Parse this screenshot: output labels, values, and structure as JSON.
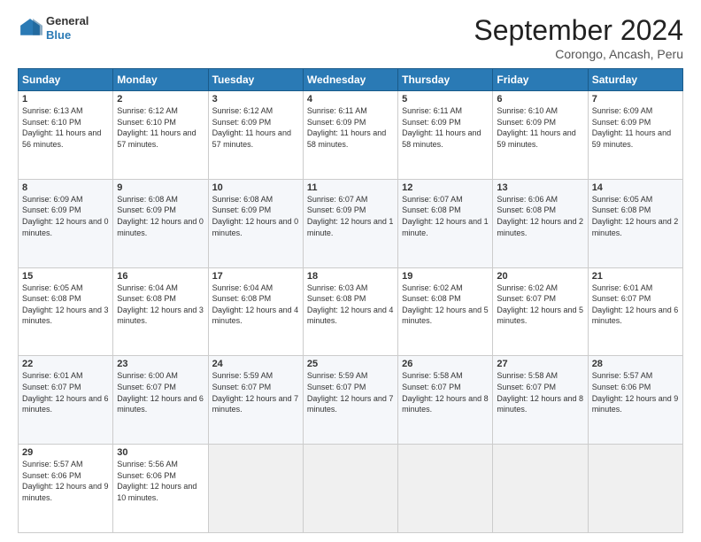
{
  "header": {
    "logo_general": "General",
    "logo_blue": "Blue",
    "month_year": "September 2024",
    "location": "Corongo, Ancash, Peru"
  },
  "days_of_week": [
    "Sunday",
    "Monday",
    "Tuesday",
    "Wednesday",
    "Thursday",
    "Friday",
    "Saturday"
  ],
  "weeks": [
    [
      {
        "day": "1",
        "sunrise": "6:13 AM",
        "sunset": "6:10 PM",
        "daylight": "11 hours and 56 minutes."
      },
      {
        "day": "2",
        "sunrise": "6:12 AM",
        "sunset": "6:10 PM",
        "daylight": "11 hours and 57 minutes."
      },
      {
        "day": "3",
        "sunrise": "6:12 AM",
        "sunset": "6:09 PM",
        "daylight": "11 hours and 57 minutes."
      },
      {
        "day": "4",
        "sunrise": "6:11 AM",
        "sunset": "6:09 PM",
        "daylight": "11 hours and 58 minutes."
      },
      {
        "day": "5",
        "sunrise": "6:11 AM",
        "sunset": "6:09 PM",
        "daylight": "11 hours and 58 minutes."
      },
      {
        "day": "6",
        "sunrise": "6:10 AM",
        "sunset": "6:09 PM",
        "daylight": "11 hours and 59 minutes."
      },
      {
        "day": "7",
        "sunrise": "6:09 AM",
        "sunset": "6:09 PM",
        "daylight": "11 hours and 59 minutes."
      }
    ],
    [
      {
        "day": "8",
        "sunrise": "6:09 AM",
        "sunset": "6:09 PM",
        "daylight": "12 hours and 0 minutes."
      },
      {
        "day": "9",
        "sunrise": "6:08 AM",
        "sunset": "6:09 PM",
        "daylight": "12 hours and 0 minutes."
      },
      {
        "day": "10",
        "sunrise": "6:08 AM",
        "sunset": "6:09 PM",
        "daylight": "12 hours and 0 minutes."
      },
      {
        "day": "11",
        "sunrise": "6:07 AM",
        "sunset": "6:09 PM",
        "daylight": "12 hours and 1 minute."
      },
      {
        "day": "12",
        "sunrise": "6:07 AM",
        "sunset": "6:08 PM",
        "daylight": "12 hours and 1 minute."
      },
      {
        "day": "13",
        "sunrise": "6:06 AM",
        "sunset": "6:08 PM",
        "daylight": "12 hours and 2 minutes."
      },
      {
        "day": "14",
        "sunrise": "6:05 AM",
        "sunset": "6:08 PM",
        "daylight": "12 hours and 2 minutes."
      }
    ],
    [
      {
        "day": "15",
        "sunrise": "6:05 AM",
        "sunset": "6:08 PM",
        "daylight": "12 hours and 3 minutes."
      },
      {
        "day": "16",
        "sunrise": "6:04 AM",
        "sunset": "6:08 PM",
        "daylight": "12 hours and 3 minutes."
      },
      {
        "day": "17",
        "sunrise": "6:04 AM",
        "sunset": "6:08 PM",
        "daylight": "12 hours and 4 minutes."
      },
      {
        "day": "18",
        "sunrise": "6:03 AM",
        "sunset": "6:08 PM",
        "daylight": "12 hours and 4 minutes."
      },
      {
        "day": "19",
        "sunrise": "6:02 AM",
        "sunset": "6:08 PM",
        "daylight": "12 hours and 5 minutes."
      },
      {
        "day": "20",
        "sunrise": "6:02 AM",
        "sunset": "6:07 PM",
        "daylight": "12 hours and 5 minutes."
      },
      {
        "day": "21",
        "sunrise": "6:01 AM",
        "sunset": "6:07 PM",
        "daylight": "12 hours and 6 minutes."
      }
    ],
    [
      {
        "day": "22",
        "sunrise": "6:01 AM",
        "sunset": "6:07 PM",
        "daylight": "12 hours and 6 minutes."
      },
      {
        "day": "23",
        "sunrise": "6:00 AM",
        "sunset": "6:07 PM",
        "daylight": "12 hours and 6 minutes."
      },
      {
        "day": "24",
        "sunrise": "5:59 AM",
        "sunset": "6:07 PM",
        "daylight": "12 hours and 7 minutes."
      },
      {
        "day": "25",
        "sunrise": "5:59 AM",
        "sunset": "6:07 PM",
        "daylight": "12 hours and 7 minutes."
      },
      {
        "day": "26",
        "sunrise": "5:58 AM",
        "sunset": "6:07 PM",
        "daylight": "12 hours and 8 minutes."
      },
      {
        "day": "27",
        "sunrise": "5:58 AM",
        "sunset": "6:07 PM",
        "daylight": "12 hours and 8 minutes."
      },
      {
        "day": "28",
        "sunrise": "5:57 AM",
        "sunset": "6:06 PM",
        "daylight": "12 hours and 9 minutes."
      }
    ],
    [
      {
        "day": "29",
        "sunrise": "5:57 AM",
        "sunset": "6:06 PM",
        "daylight": "12 hours and 9 minutes."
      },
      {
        "day": "30",
        "sunrise": "5:56 AM",
        "sunset": "6:06 PM",
        "daylight": "12 hours and 10 minutes."
      },
      null,
      null,
      null,
      null,
      null
    ]
  ]
}
